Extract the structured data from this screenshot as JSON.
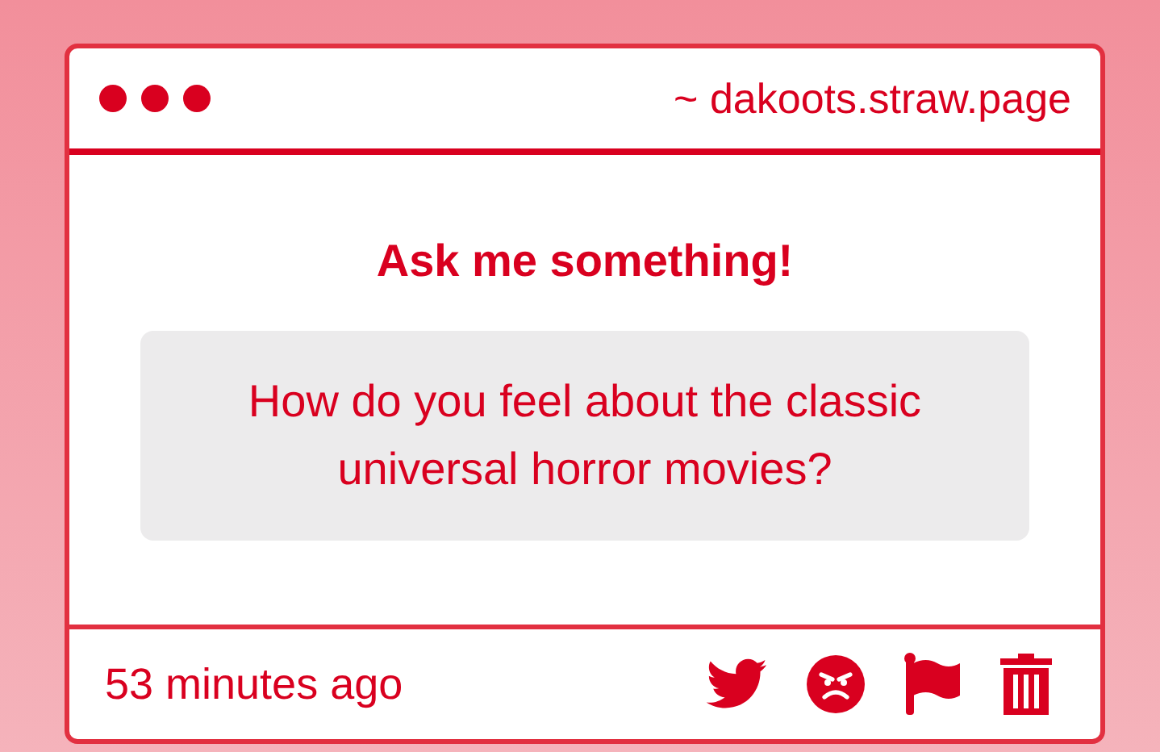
{
  "window": {
    "address": "~ dakoots.straw.page"
  },
  "heading": "Ask me something!",
  "question": "How do you feel about the classic universal horror movies?",
  "footer": {
    "time": "53 minutes ago"
  }
}
